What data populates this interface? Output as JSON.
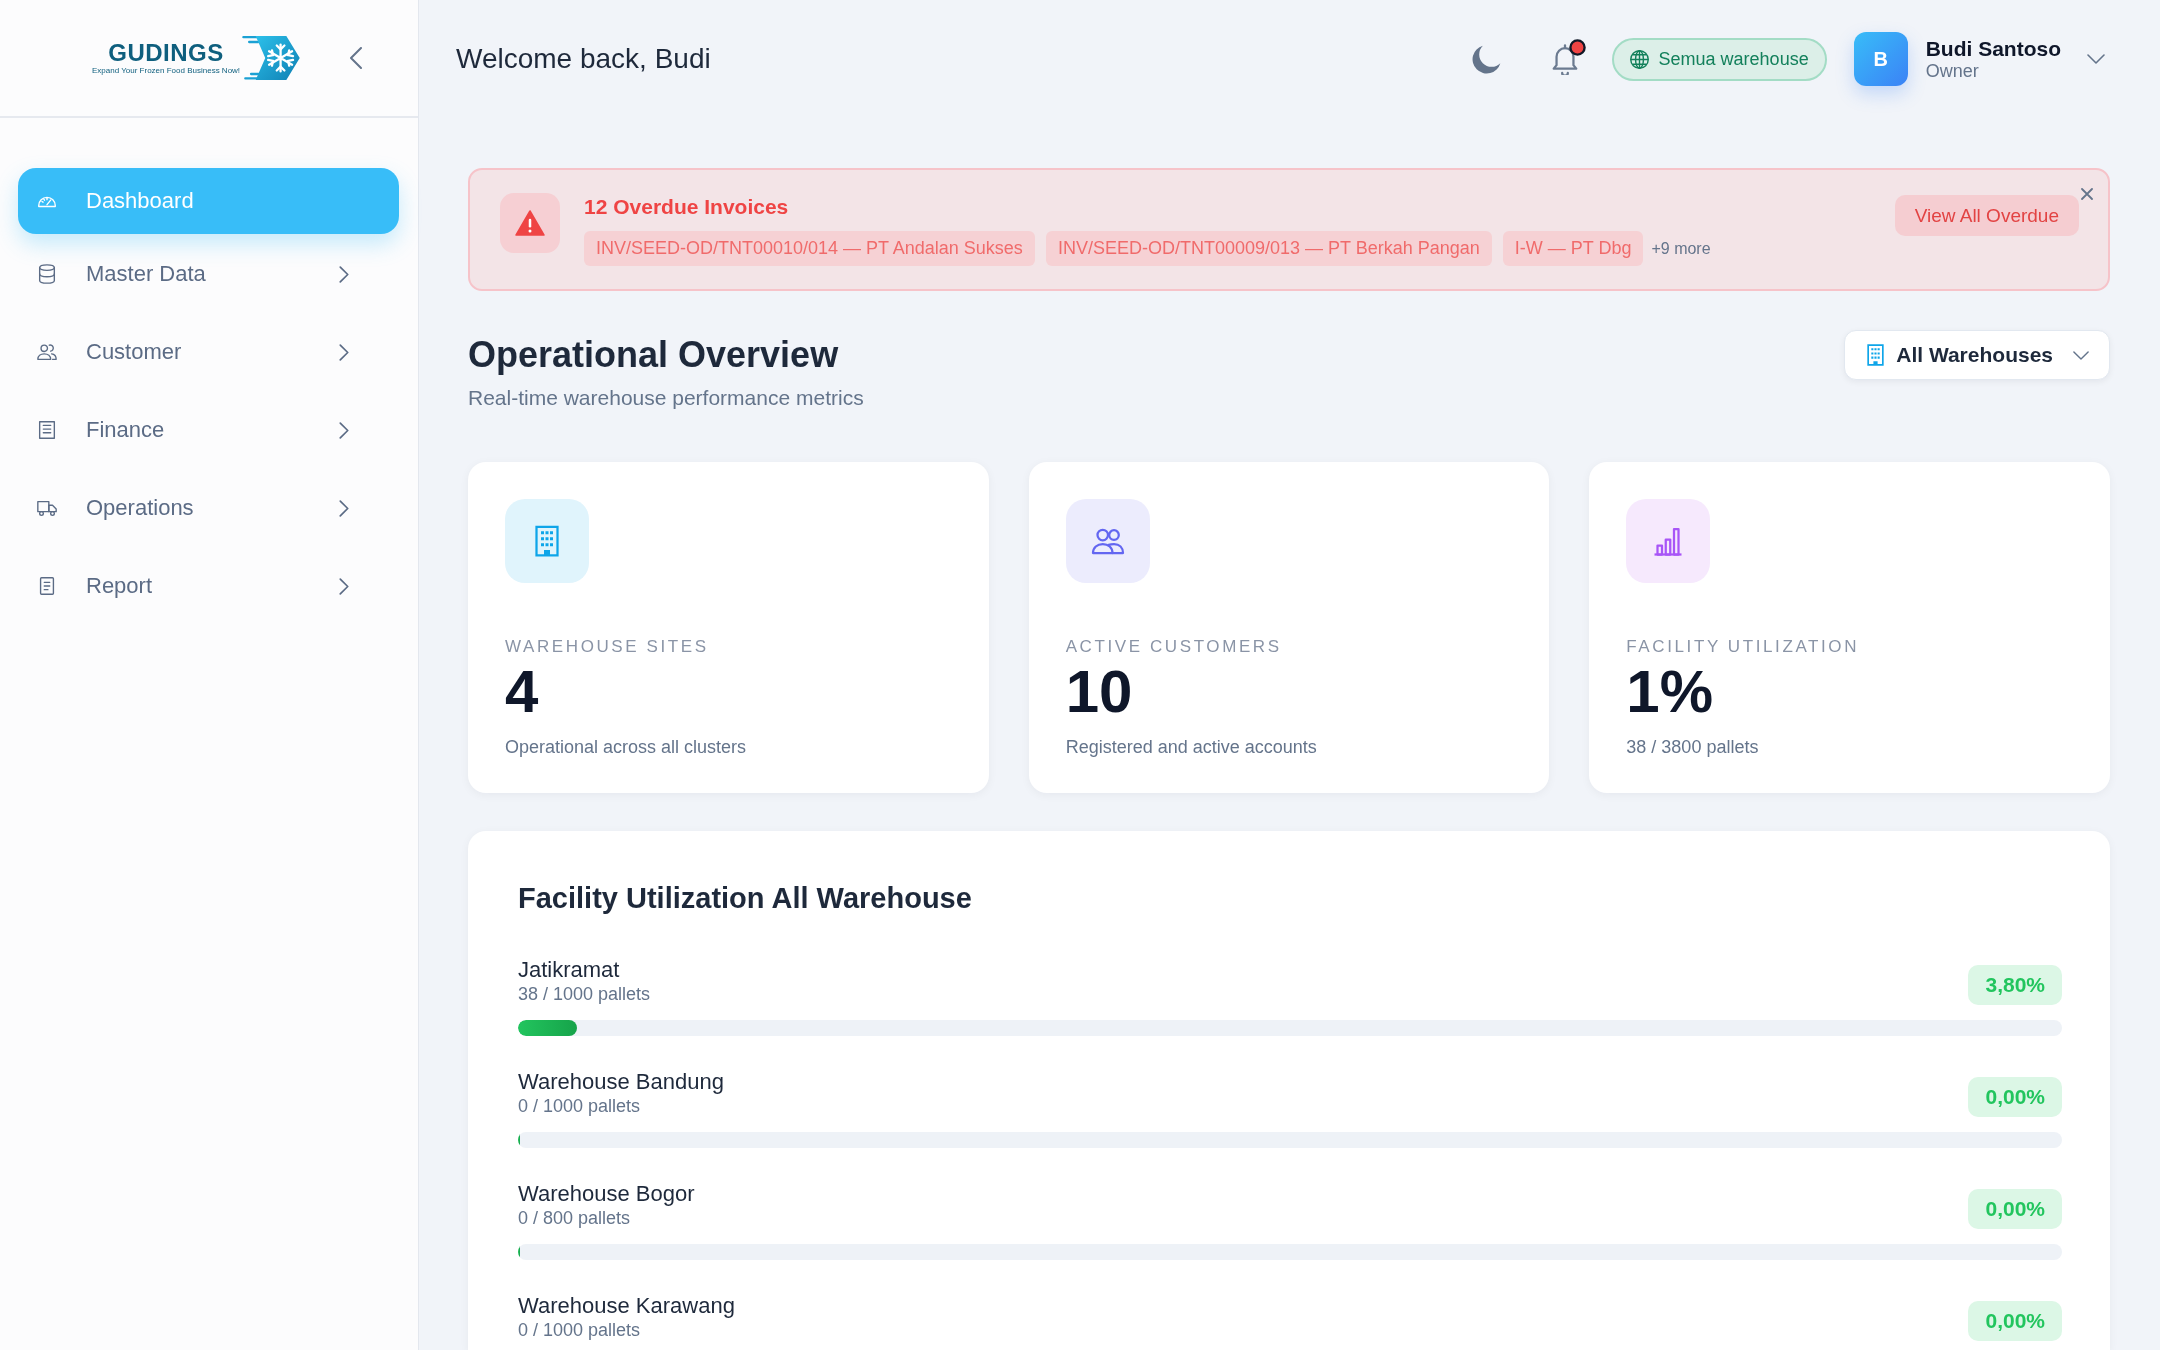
{
  "sidebar": {
    "logo": {
      "name": "GUDINGS",
      "tagline": "Expand Your Frozen Food Business Now!"
    },
    "items": [
      {
        "label": "Dashboard",
        "kind": "gauge",
        "selected": true,
        "has_children": false
      },
      {
        "label": "Master Data",
        "kind": "database",
        "selected": false,
        "has_children": true
      },
      {
        "label": "Customer",
        "kind": "users",
        "selected": false,
        "has_children": true
      },
      {
        "label": "Finance",
        "kind": "receipt",
        "selected": false,
        "has_children": true
      },
      {
        "label": "Operations",
        "kind": "truck",
        "selected": false,
        "has_children": true
      },
      {
        "label": "Report",
        "kind": "document",
        "selected": false,
        "has_children": true
      }
    ]
  },
  "header": {
    "greeting": "Welcome back, Budi",
    "unread_notifications": true,
    "scope": "Semua warehouse",
    "user": {
      "initial": "B",
      "name": "Budi Santoso",
      "role": "Owner"
    }
  },
  "alert": {
    "title": "12 Overdue Invoices",
    "invoices": [
      "INV/SEED-OD/TNT00010/014 — PT Andalan Sukses",
      "INV/SEED-OD/TNT00009/013 — PT Berkah Pangan",
      "I-W — PT Dbg"
    ],
    "more": "+9 more",
    "action": "View All Overdue"
  },
  "overview": {
    "title": "Operational Overview",
    "subtitle": "Real-time warehouse performance metrics",
    "filter": "All Warehouses",
    "cards": [
      {
        "kind": "building",
        "label": "WAREHOUSE SITES",
        "value": "4",
        "description": "Operational across all clusters"
      },
      {
        "kind": "users",
        "label": "ACTIVE CUSTOMERS",
        "value": "10",
        "description": "Registered and active accounts"
      },
      {
        "kind": "chart",
        "label": "FACILITY UTILIZATION",
        "value": "1%",
        "description": "38 / 3800 pallets"
      }
    ]
  },
  "facility": {
    "title": "Facility Utilization All Warehouse",
    "rows": [
      {
        "name": "Jatikramat",
        "capacity": "38 / 1000 pallets",
        "percent": "3,80%",
        "level": 0.038
      },
      {
        "name": "Warehouse Bandung",
        "capacity": "0 / 1000 pallets",
        "percent": "0,00%",
        "level": 0
      },
      {
        "name": "Warehouse Bogor",
        "capacity": "0 / 800 pallets",
        "percent": "0,00%",
        "level": 0
      },
      {
        "name": "Warehouse Karawang",
        "capacity": "0 / 1000 pallets",
        "percent": "0,00%"
      }
    ]
  }
}
